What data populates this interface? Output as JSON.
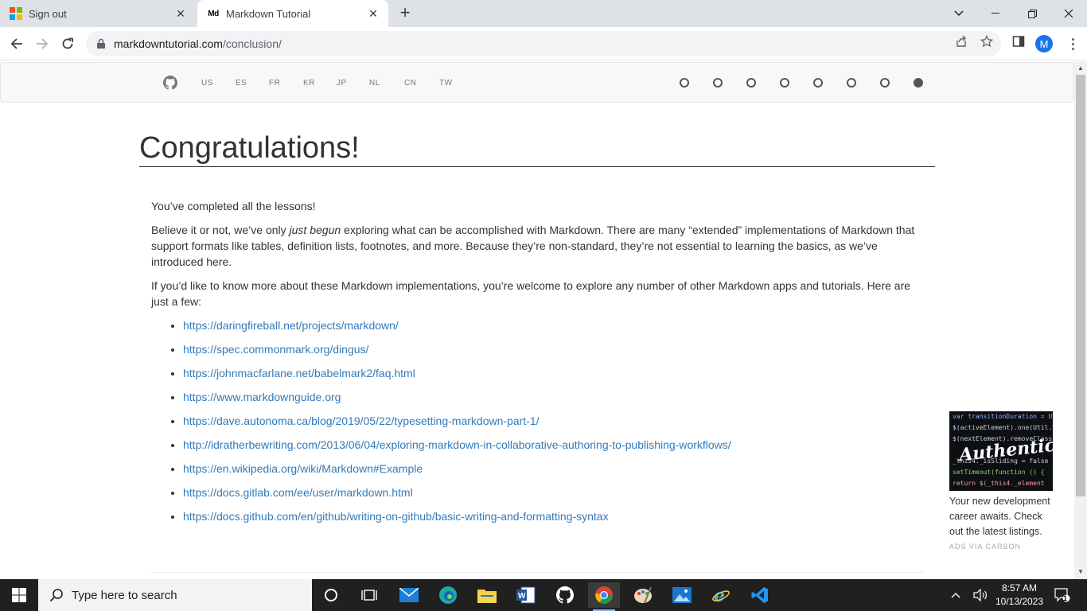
{
  "browser": {
    "tabs": [
      {
        "title": "Sign out",
        "favicon": "microsoft-logo-icon",
        "active": false
      },
      {
        "title": "Markdown Tutorial",
        "favicon": "md-icon",
        "active": true
      }
    ],
    "favicon_md_text": "Md",
    "url_host": "markdowntutorial.com",
    "url_path": "/conclusion/",
    "profile_initial": "M"
  },
  "sitenav": {
    "languages": [
      "US",
      "ES",
      "FR",
      "KR",
      "JP",
      "NL",
      "CN",
      "TW"
    ],
    "progress": {
      "total_steps": 8,
      "current_step": 8
    }
  },
  "page": {
    "title": "Congratulations!",
    "intro": "You’ve completed all the lessons!",
    "p2_before": "Believe it or not, we’ve only ",
    "p2_em": "just begun",
    "p2_after": " exploring what can be accomplished with Markdown. There are many “extended” implementations of Markdown that support formats like tables, definition lists, footnotes, and more. Because they’re non-standard, they’re not essential to learning the basics, as we’ve introduced here.",
    "p3": "If you’d like to know more about these Markdown implementations, you’re welcome to explore any number of other Markdown apps and tutorials. Here are just a few:",
    "links": [
      "https://daringfireball.net/projects/markdown/",
      "https://spec.commonmark.org/dingus/",
      "https://johnmacfarlane.net/babelmark2/faq.html",
      "https://www.markdownguide.org",
      "https://dave.autonoma.ca/blog/2019/05/22/typesetting-markdown-part-1/",
      "http://idratherbewriting.com/2013/06/04/exploring-markdown-in-collaborative-authoring-to-publishing-workflows/",
      "https://en.wikipedia.org/wiki/Markdown#Example",
      "https://docs.gitlab.com/ee/user/markdown.html",
      "https://docs.github.com/en/github/writing-on-github/basic-writing-and-formatting-syntax"
    ]
  },
  "ad": {
    "brand": "Authentic",
    "code_lines": [
      "var transitionDuration = Util",
      "$(activeElement).one(Util.TR",
      "$(nextElement).removeClass",
      "_this4._isSliding = false",
      "setTimeout(function () {",
      "  return $(_this4._element"
    ],
    "text": "Your new development career awaits. Check out the latest listings.",
    "via": "ADS VIA CARBON"
  },
  "taskbar": {
    "search_placeholder": "Type here to search",
    "time": "8:57 AM",
    "date": "10/13/2023",
    "notification_count": "1"
  },
  "colors": {
    "link": "#337ab7",
    "text": "#333333",
    "taskbar": "#202020",
    "tabstrip": "#dee1e6"
  }
}
